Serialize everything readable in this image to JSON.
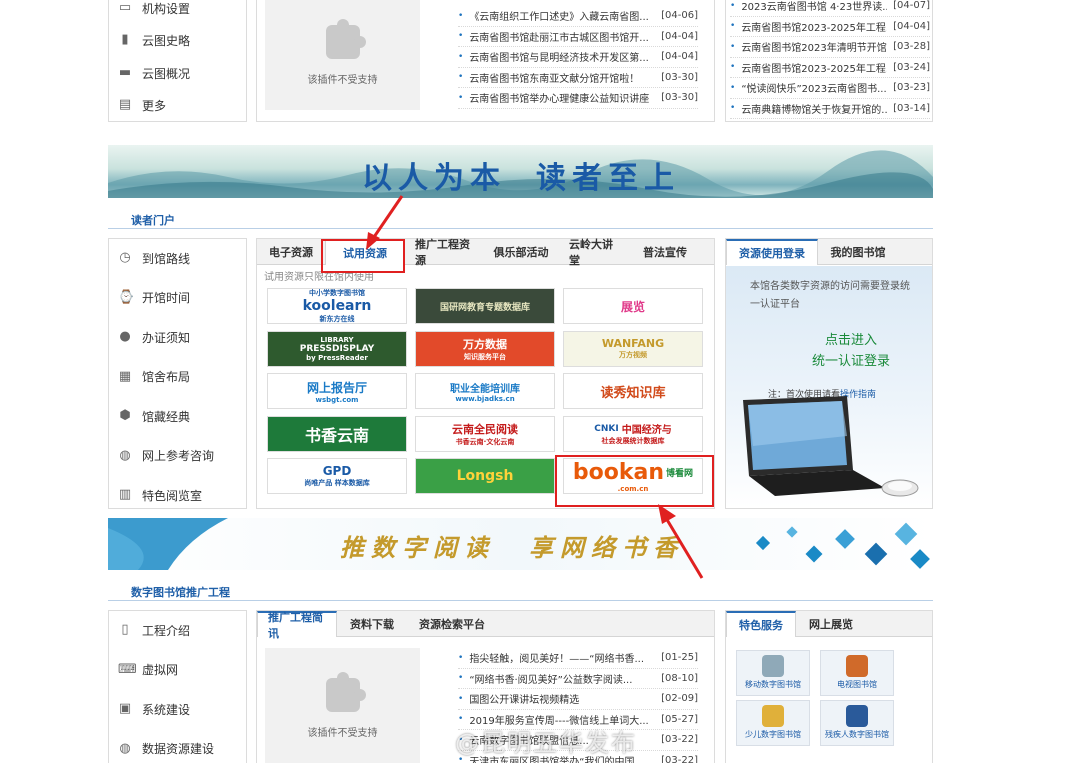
{
  "top_sidebar": {
    "items": [
      {
        "label": "机构设置",
        "icon": "monitor-icon"
      },
      {
        "label": "云图史略",
        "icon": "book-icon"
      },
      {
        "label": "云图概况",
        "icon": "screen-icon"
      },
      {
        "label": "更多",
        "icon": "document-icon"
      }
    ]
  },
  "plugin_text": "该插件不受支持",
  "top_news_middle": [
    {
      "title": "《云南组织工作口述史》入藏云南省图...",
      "date": "[04-06]"
    },
    {
      "title": "云南省图书馆赴丽江市古城区图书馆开...",
      "date": "[04-04]"
    },
    {
      "title": "云南省图书馆与昆明经济技术开发区第...",
      "date": "[04-04]"
    },
    {
      "title": "云南省图书馆东南亚文献分馆开馆啦！",
      "date": "[03-30]"
    },
    {
      "title": "云南省图书馆举办心理健康公益知识讲座",
      "date": "[03-30]"
    }
  ],
  "top_news_right": [
    {
      "title": "2023云南省图书馆 4·23世界读...",
      "date": "[04-07]"
    },
    {
      "title": "云南省图书馆2023-2025年工程...",
      "date": "[04-04]"
    },
    {
      "title": "云南省图书馆2023年清明节开馆...",
      "date": "[03-28]"
    },
    {
      "title": "云南省图书馆2023-2025年工程...",
      "date": "[03-24]"
    },
    {
      "title": "“悦读阅快乐”2023云南省图书...",
      "date": "[03-23]"
    },
    {
      "title": "云南典籍博物馆关于恢复开馆的...",
      "date": "[03-14]"
    }
  ],
  "banner1": {
    "part1": "以人为本",
    "part2": "读者至上"
  },
  "reader_portal": {
    "title": "读者门户",
    "sidebar": [
      {
        "label": "到馆路线",
        "icon": "clock-icon"
      },
      {
        "label": "开馆时间",
        "icon": "watch-icon"
      },
      {
        "label": "办证须知",
        "icon": "bulb-icon"
      },
      {
        "label": "馆舍布局",
        "icon": "layout-icon"
      },
      {
        "label": "馆藏经典",
        "icon": "box-icon"
      },
      {
        "label": "网上参考咨询",
        "icon": "globe-icon"
      },
      {
        "label": "特色阅览室",
        "icon": "open-book-icon"
      }
    ],
    "tabs": [
      "电子资源",
      "试用资源",
      "推广工程资源",
      "俱乐部活动",
      "云岭大讲堂",
      "普法宣传"
    ],
    "active_tab": 1,
    "note": "试用资源只限在馆内使用",
    "logos": [
      {
        "top": "中小学数字图书馆",
        "main": "koolearn",
        "sub": "新东方在线"
      },
      {
        "main": "国研网教育专题数据库"
      },
      {
        "main": "展览"
      },
      {
        "top": "LIBRARY",
        "main": "PRESSDISPLAY",
        "sub": "by PressReader"
      },
      {
        "main": "万方数据",
        "sub": "知识服务平台"
      },
      {
        "main": "WANFANG",
        "sub": "万方视频"
      },
      {
        "main": "网上报告厅",
        "sub": "wsbgt.com"
      },
      {
        "main": "职业全能培训库",
        "sub": "www.bjadks.cn"
      },
      {
        "main": "读秀知识库"
      },
      {
        "main": "书香云南"
      },
      {
        "main": "云南全民阅读",
        "sub": "书香云南·文化云南"
      },
      {
        "main": "中国经济与",
        "sub": "社会发展统计数据库",
        "brand": "CNKI"
      },
      {
        "main": "GPD",
        "sub": "尚唯产品 样本数据库"
      },
      {
        "main": "Longsh"
      },
      {
        "main": "bookan",
        "sub": ".com.cn",
        "tag": "博看网"
      }
    ],
    "login_tabs": [
      "资源使用登录",
      "我的图书馆"
    ],
    "login_text": "本馆各类数字资源的访问需要登录统一认证平台",
    "login_button_1": "点击进入",
    "login_button_2": "统一认证登录",
    "login_note_prefix": "注：首次使用请看",
    "login_note_link": "操作指南"
  },
  "banner2": {
    "part1": "推数字阅读",
    "part2": "享网络书香"
  },
  "digital_lib": {
    "title": "数字图书馆推广工程",
    "sidebar": [
      {
        "label": "工程介绍",
        "icon": "doc-icon"
      },
      {
        "label": "虚拟网",
        "icon": "keyboard-icon"
      },
      {
        "label": "系统建设",
        "icon": "display-icon"
      },
      {
        "label": "数据资源建设",
        "icon": "globe-icon"
      }
    ],
    "tabs": [
      "推广工程简讯",
      "资料下载",
      "资源检索平台"
    ],
    "news": [
      {
        "title": "指尖轻触，阅见美好！——“网络书香...",
        "date": "[01-25]"
      },
      {
        "title": "“网络书香·阅见美好”公益数字阅读...",
        "date": "[08-10]"
      },
      {
        "title": "国图公开课讲坛视频精选",
        "date": "[02-09]"
      },
      {
        "title": "2019年服务宣传周----微信线上单词大...",
        "date": "[05-27]"
      },
      {
        "title": "云南数字图书馆联盟信息...",
        "date": "[03-22]"
      },
      {
        "title": "天津市东丽区图书馆举办“我们的中国...",
        "date": "[03-22]"
      }
    ],
    "right_tabs": [
      "特色服务",
      "网上展览"
    ],
    "services": [
      "移动数字图书馆",
      "电视图书馆",
      "少儿数字图书馆",
      "残疾人数字图书馆"
    ]
  },
  "watermark": "@昆明五华发布"
}
